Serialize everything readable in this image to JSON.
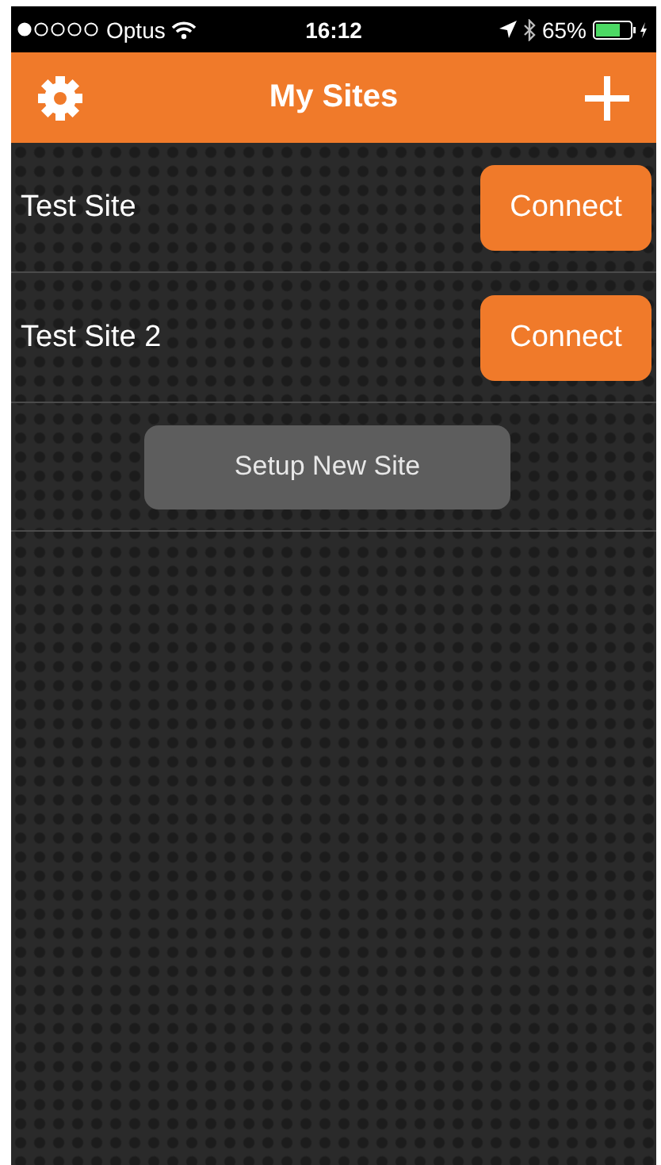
{
  "status_bar": {
    "carrier": "Optus",
    "time": "16:12",
    "battery": "65%"
  },
  "nav_bar": {
    "title": "My Sites"
  },
  "sites": [
    {
      "name": "Test Site",
      "button": "Connect"
    },
    {
      "name": "Test Site 2",
      "button": "Connect"
    }
  ],
  "setup_button": "Setup New Site"
}
